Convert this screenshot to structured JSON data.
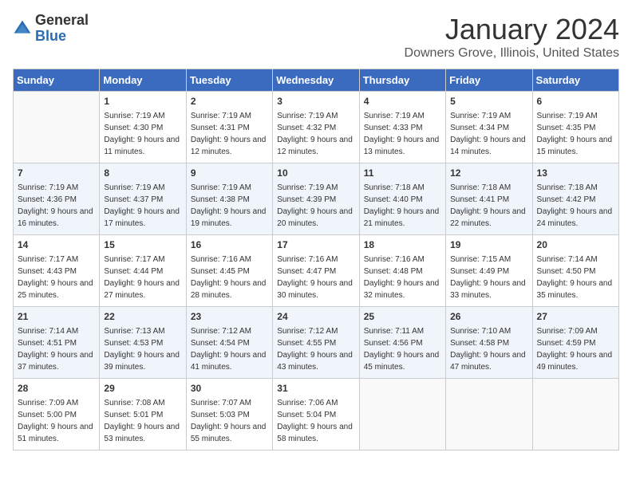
{
  "header": {
    "logo_line1": "General",
    "logo_line2": "Blue",
    "title": "January 2024",
    "subtitle": "Downers Grove, Illinois, United States"
  },
  "days_of_week": [
    "Sunday",
    "Monday",
    "Tuesday",
    "Wednesday",
    "Thursday",
    "Friday",
    "Saturday"
  ],
  "weeks": [
    [
      {
        "day": "",
        "sunrise": "",
        "sunset": "",
        "daylight": "",
        "empty": true
      },
      {
        "day": "1",
        "sunrise": "Sunrise: 7:19 AM",
        "sunset": "Sunset: 4:30 PM",
        "daylight": "Daylight: 9 hours and 11 minutes."
      },
      {
        "day": "2",
        "sunrise": "Sunrise: 7:19 AM",
        "sunset": "Sunset: 4:31 PM",
        "daylight": "Daylight: 9 hours and 12 minutes."
      },
      {
        "day": "3",
        "sunrise": "Sunrise: 7:19 AM",
        "sunset": "Sunset: 4:32 PM",
        "daylight": "Daylight: 9 hours and 12 minutes."
      },
      {
        "day": "4",
        "sunrise": "Sunrise: 7:19 AM",
        "sunset": "Sunset: 4:33 PM",
        "daylight": "Daylight: 9 hours and 13 minutes."
      },
      {
        "day": "5",
        "sunrise": "Sunrise: 7:19 AM",
        "sunset": "Sunset: 4:34 PM",
        "daylight": "Daylight: 9 hours and 14 minutes."
      },
      {
        "day": "6",
        "sunrise": "Sunrise: 7:19 AM",
        "sunset": "Sunset: 4:35 PM",
        "daylight": "Daylight: 9 hours and 15 minutes."
      }
    ],
    [
      {
        "day": "7",
        "sunrise": "Sunrise: 7:19 AM",
        "sunset": "Sunset: 4:36 PM",
        "daylight": "Daylight: 9 hours and 16 minutes."
      },
      {
        "day": "8",
        "sunrise": "Sunrise: 7:19 AM",
        "sunset": "Sunset: 4:37 PM",
        "daylight": "Daylight: 9 hours and 17 minutes."
      },
      {
        "day": "9",
        "sunrise": "Sunrise: 7:19 AM",
        "sunset": "Sunset: 4:38 PM",
        "daylight": "Daylight: 9 hours and 19 minutes."
      },
      {
        "day": "10",
        "sunrise": "Sunrise: 7:19 AM",
        "sunset": "Sunset: 4:39 PM",
        "daylight": "Daylight: 9 hours and 20 minutes."
      },
      {
        "day": "11",
        "sunrise": "Sunrise: 7:18 AM",
        "sunset": "Sunset: 4:40 PM",
        "daylight": "Daylight: 9 hours and 21 minutes."
      },
      {
        "day": "12",
        "sunrise": "Sunrise: 7:18 AM",
        "sunset": "Sunset: 4:41 PM",
        "daylight": "Daylight: 9 hours and 22 minutes."
      },
      {
        "day": "13",
        "sunrise": "Sunrise: 7:18 AM",
        "sunset": "Sunset: 4:42 PM",
        "daylight": "Daylight: 9 hours and 24 minutes."
      }
    ],
    [
      {
        "day": "14",
        "sunrise": "Sunrise: 7:17 AM",
        "sunset": "Sunset: 4:43 PM",
        "daylight": "Daylight: 9 hours and 25 minutes."
      },
      {
        "day": "15",
        "sunrise": "Sunrise: 7:17 AM",
        "sunset": "Sunset: 4:44 PM",
        "daylight": "Daylight: 9 hours and 27 minutes."
      },
      {
        "day": "16",
        "sunrise": "Sunrise: 7:16 AM",
        "sunset": "Sunset: 4:45 PM",
        "daylight": "Daylight: 9 hours and 28 minutes."
      },
      {
        "day": "17",
        "sunrise": "Sunrise: 7:16 AM",
        "sunset": "Sunset: 4:47 PM",
        "daylight": "Daylight: 9 hours and 30 minutes."
      },
      {
        "day": "18",
        "sunrise": "Sunrise: 7:16 AM",
        "sunset": "Sunset: 4:48 PM",
        "daylight": "Daylight: 9 hours and 32 minutes."
      },
      {
        "day": "19",
        "sunrise": "Sunrise: 7:15 AM",
        "sunset": "Sunset: 4:49 PM",
        "daylight": "Daylight: 9 hours and 33 minutes."
      },
      {
        "day": "20",
        "sunrise": "Sunrise: 7:14 AM",
        "sunset": "Sunset: 4:50 PM",
        "daylight": "Daylight: 9 hours and 35 minutes."
      }
    ],
    [
      {
        "day": "21",
        "sunrise": "Sunrise: 7:14 AM",
        "sunset": "Sunset: 4:51 PM",
        "daylight": "Daylight: 9 hours and 37 minutes."
      },
      {
        "day": "22",
        "sunrise": "Sunrise: 7:13 AM",
        "sunset": "Sunset: 4:53 PM",
        "daylight": "Daylight: 9 hours and 39 minutes."
      },
      {
        "day": "23",
        "sunrise": "Sunrise: 7:12 AM",
        "sunset": "Sunset: 4:54 PM",
        "daylight": "Daylight: 9 hours and 41 minutes."
      },
      {
        "day": "24",
        "sunrise": "Sunrise: 7:12 AM",
        "sunset": "Sunset: 4:55 PM",
        "daylight": "Daylight: 9 hours and 43 minutes."
      },
      {
        "day": "25",
        "sunrise": "Sunrise: 7:11 AM",
        "sunset": "Sunset: 4:56 PM",
        "daylight": "Daylight: 9 hours and 45 minutes."
      },
      {
        "day": "26",
        "sunrise": "Sunrise: 7:10 AM",
        "sunset": "Sunset: 4:58 PM",
        "daylight": "Daylight: 9 hours and 47 minutes."
      },
      {
        "day": "27",
        "sunrise": "Sunrise: 7:09 AM",
        "sunset": "Sunset: 4:59 PM",
        "daylight": "Daylight: 9 hours and 49 minutes."
      }
    ],
    [
      {
        "day": "28",
        "sunrise": "Sunrise: 7:09 AM",
        "sunset": "Sunset: 5:00 PM",
        "daylight": "Daylight: 9 hours and 51 minutes."
      },
      {
        "day": "29",
        "sunrise": "Sunrise: 7:08 AM",
        "sunset": "Sunset: 5:01 PM",
        "daylight": "Daylight: 9 hours and 53 minutes."
      },
      {
        "day": "30",
        "sunrise": "Sunrise: 7:07 AM",
        "sunset": "Sunset: 5:03 PM",
        "daylight": "Daylight: 9 hours and 55 minutes."
      },
      {
        "day": "31",
        "sunrise": "Sunrise: 7:06 AM",
        "sunset": "Sunset: 5:04 PM",
        "daylight": "Daylight: 9 hours and 58 minutes."
      },
      {
        "day": "",
        "sunrise": "",
        "sunset": "",
        "daylight": "",
        "empty": true
      },
      {
        "day": "",
        "sunrise": "",
        "sunset": "",
        "daylight": "",
        "empty": true
      },
      {
        "day": "",
        "sunrise": "",
        "sunset": "",
        "daylight": "",
        "empty": true
      }
    ]
  ]
}
